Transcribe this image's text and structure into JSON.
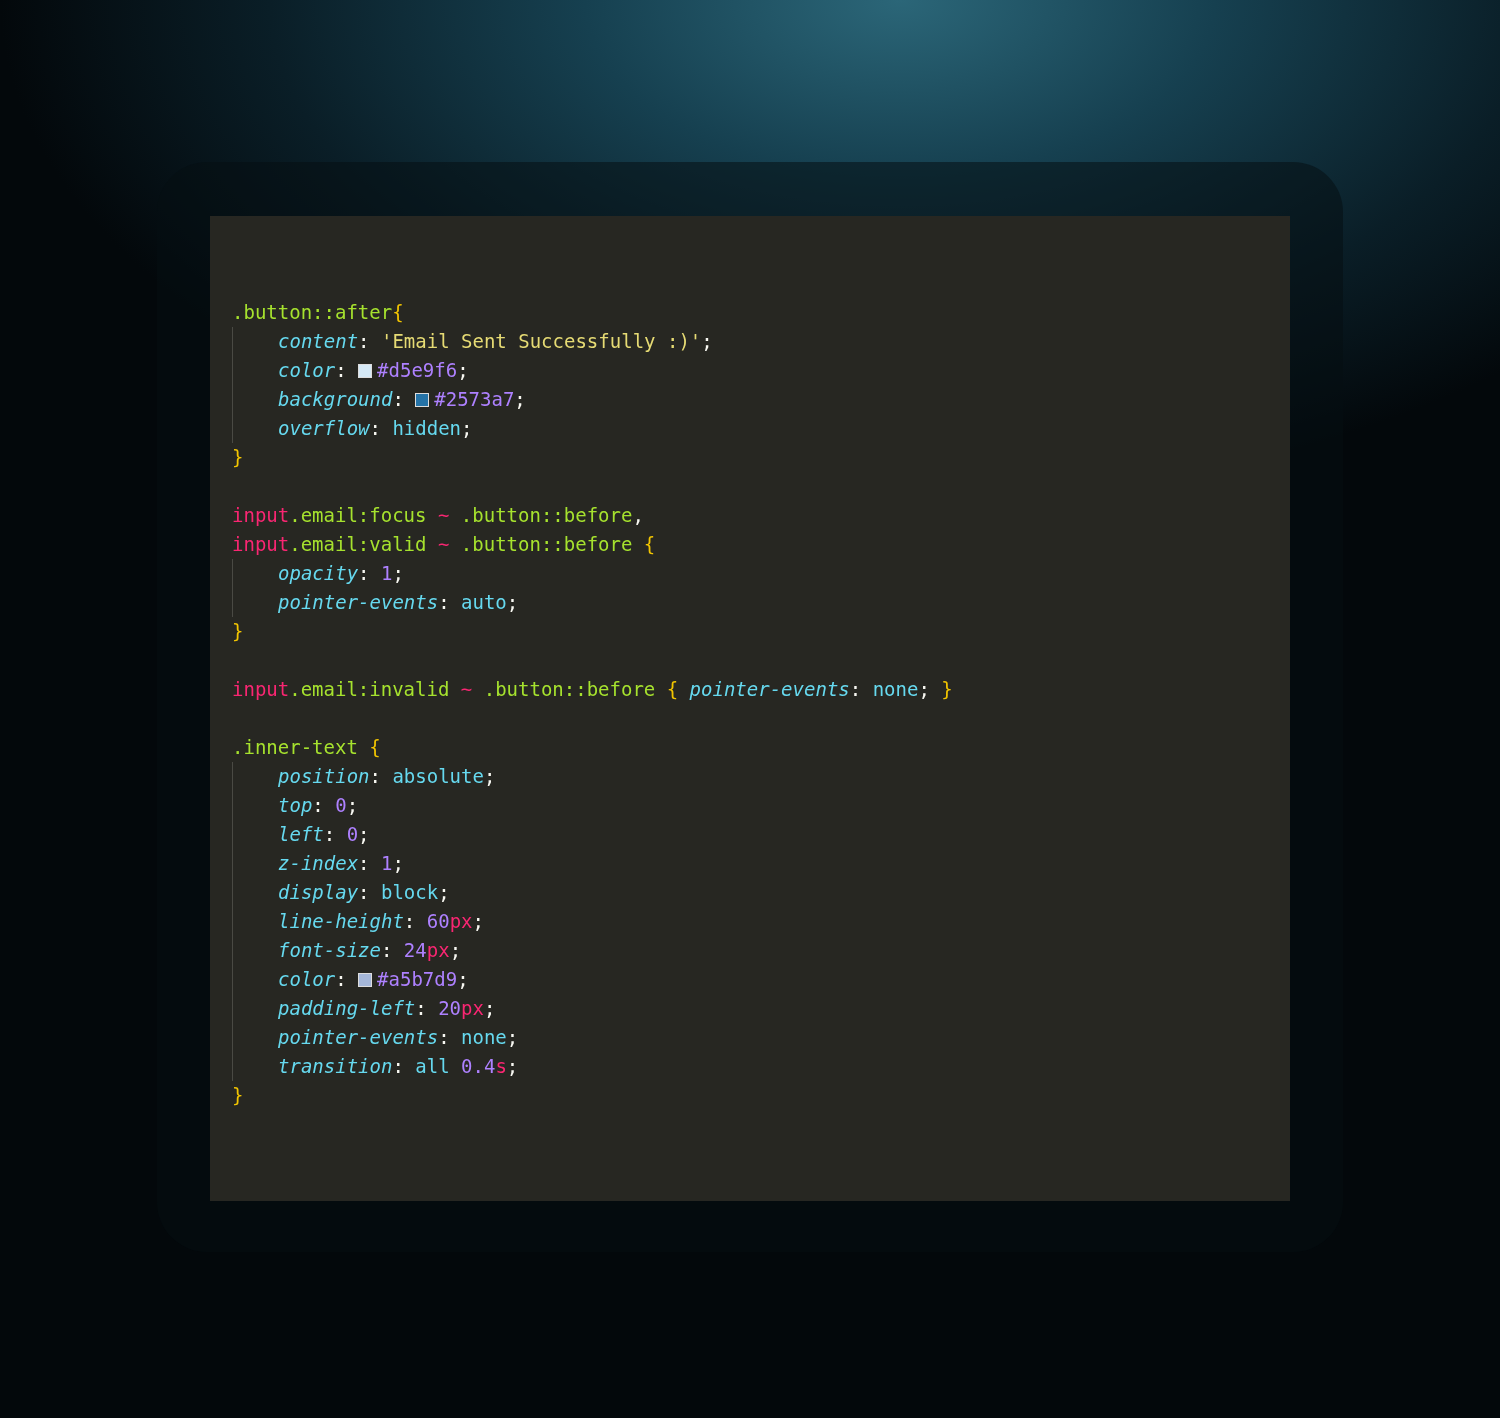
{
  "blocks": [
    {
      "header": [
        [
          {
            "kind": "class",
            "text": ".button::after"
          },
          {
            "kind": "brace",
            "text": "{"
          }
        ]
      ],
      "body": [
        [
          {
            "kind": "prop",
            "text": "content"
          },
          {
            "kind": "punct",
            "text": ": "
          },
          {
            "kind": "string",
            "text": "'Email Sent Successfully :)'"
          },
          {
            "kind": "punct",
            "text": ";"
          }
        ],
        [
          {
            "kind": "prop",
            "text": "color"
          },
          {
            "kind": "punct",
            "text": ": "
          },
          {
            "kind": "swatch",
            "color": "#d5e9f6"
          },
          {
            "kind": "number",
            "text": "#d5e9f6"
          },
          {
            "kind": "punct",
            "text": ";"
          }
        ],
        [
          {
            "kind": "prop",
            "text": "background"
          },
          {
            "kind": "punct",
            "text": ": "
          },
          {
            "kind": "swatch",
            "color": "#2573a7"
          },
          {
            "kind": "number",
            "text": "#2573a7"
          },
          {
            "kind": "punct",
            "text": ";"
          }
        ],
        [
          {
            "kind": "prop",
            "text": "overflow"
          },
          {
            "kind": "punct",
            "text": ": "
          },
          {
            "kind": "value",
            "text": "hidden"
          },
          {
            "kind": "punct",
            "text": ";"
          }
        ]
      ],
      "footer": [
        {
          "kind": "brace",
          "text": "}"
        }
      ]
    },
    {
      "header": [
        [
          {
            "kind": "tag",
            "text": "input"
          },
          {
            "kind": "class",
            "text": ".email:focus"
          },
          {
            "kind": "tag",
            "text": " ~ "
          },
          {
            "kind": "class",
            "text": ".button::before"
          },
          {
            "kind": "punct",
            "text": ","
          }
        ],
        [
          {
            "kind": "tag",
            "text": "input"
          },
          {
            "kind": "class",
            "text": ".email:valid"
          },
          {
            "kind": "tag",
            "text": " ~ "
          },
          {
            "kind": "class",
            "text": ".button::before"
          },
          {
            "kind": "brace",
            "text": " {"
          }
        ]
      ],
      "body": [
        [
          {
            "kind": "prop",
            "text": "opacity"
          },
          {
            "kind": "punct",
            "text": ": "
          },
          {
            "kind": "number",
            "text": "1"
          },
          {
            "kind": "punct",
            "text": ";"
          }
        ],
        [
          {
            "kind": "prop",
            "text": "pointer-events"
          },
          {
            "kind": "punct",
            "text": ": "
          },
          {
            "kind": "value",
            "text": "auto"
          },
          {
            "kind": "punct",
            "text": ";"
          }
        ]
      ],
      "footer": [
        {
          "kind": "brace",
          "text": "}"
        }
      ]
    },
    {
      "header": [
        [
          {
            "kind": "tag",
            "text": "input"
          },
          {
            "kind": "class",
            "text": ".email:invalid"
          },
          {
            "kind": "tag",
            "text": " ~ "
          },
          {
            "kind": "class",
            "text": ".button::before"
          },
          {
            "kind": "brace",
            "text": " { "
          },
          {
            "kind": "prop",
            "text": "pointer-events"
          },
          {
            "kind": "punct",
            "text": ": "
          },
          {
            "kind": "value",
            "text": "none"
          },
          {
            "kind": "punct",
            "text": "; "
          },
          {
            "kind": "brace",
            "text": "}"
          }
        ]
      ]
    },
    {
      "header": [
        [
          {
            "kind": "class",
            "text": ".inner-text"
          },
          {
            "kind": "brace",
            "text": " {"
          }
        ]
      ],
      "body": [
        [
          {
            "kind": "prop",
            "text": "position"
          },
          {
            "kind": "punct",
            "text": ": "
          },
          {
            "kind": "value",
            "text": "absolute"
          },
          {
            "kind": "punct",
            "text": ";"
          }
        ],
        [
          {
            "kind": "prop",
            "text": "top"
          },
          {
            "kind": "punct",
            "text": ": "
          },
          {
            "kind": "number",
            "text": "0"
          },
          {
            "kind": "punct",
            "text": ";"
          }
        ],
        [
          {
            "kind": "prop",
            "text": "left"
          },
          {
            "kind": "punct",
            "text": ": "
          },
          {
            "kind": "number",
            "text": "0"
          },
          {
            "kind": "punct",
            "text": ";"
          }
        ],
        [
          {
            "kind": "prop",
            "text": "z-index"
          },
          {
            "kind": "punct",
            "text": ": "
          },
          {
            "kind": "number",
            "text": "1"
          },
          {
            "kind": "punct",
            "text": ";"
          }
        ],
        [
          {
            "kind": "prop",
            "text": "display"
          },
          {
            "kind": "punct",
            "text": ": "
          },
          {
            "kind": "value",
            "text": "block"
          },
          {
            "kind": "punct",
            "text": ";"
          }
        ],
        [
          {
            "kind": "prop",
            "text": "line-height"
          },
          {
            "kind": "punct",
            "text": ": "
          },
          {
            "kind": "number",
            "text": "60"
          },
          {
            "kind": "unit",
            "text": "px"
          },
          {
            "kind": "punct",
            "text": ";"
          }
        ],
        [
          {
            "kind": "prop",
            "text": "font-size"
          },
          {
            "kind": "punct",
            "text": ": "
          },
          {
            "kind": "number",
            "text": "24"
          },
          {
            "kind": "unit",
            "text": "px"
          },
          {
            "kind": "punct",
            "text": ";"
          }
        ],
        [
          {
            "kind": "prop",
            "text": "color"
          },
          {
            "kind": "punct",
            "text": ": "
          },
          {
            "kind": "swatch",
            "color": "#a5b7d9"
          },
          {
            "kind": "number",
            "text": "#a5b7d9"
          },
          {
            "kind": "punct",
            "text": ";"
          }
        ],
        [
          {
            "kind": "prop",
            "text": "padding-left"
          },
          {
            "kind": "punct",
            "text": ": "
          },
          {
            "kind": "number",
            "text": "20"
          },
          {
            "kind": "unit",
            "text": "px"
          },
          {
            "kind": "punct",
            "text": ";"
          }
        ],
        [
          {
            "kind": "prop",
            "text": "pointer-events"
          },
          {
            "kind": "punct",
            "text": ": "
          },
          {
            "kind": "value",
            "text": "none"
          },
          {
            "kind": "punct",
            "text": ";"
          }
        ],
        [
          {
            "kind": "prop",
            "text": "transition"
          },
          {
            "kind": "punct",
            "text": ": "
          },
          {
            "kind": "value",
            "text": "all "
          },
          {
            "kind": "number",
            "text": "0.4"
          },
          {
            "kind": "unit",
            "text": "s"
          },
          {
            "kind": "punct",
            "text": ";"
          }
        ]
      ],
      "footer": [
        {
          "kind": "brace",
          "text": "}"
        }
      ]
    }
  ]
}
